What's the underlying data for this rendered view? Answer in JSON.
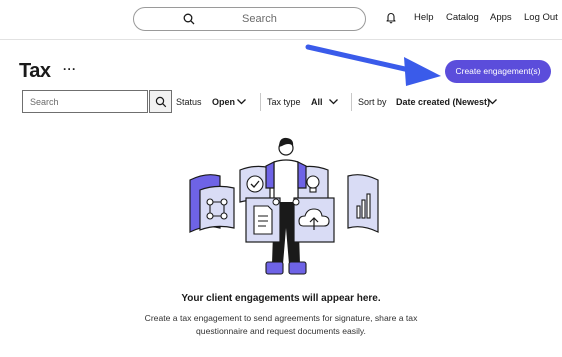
{
  "topbar": {
    "search_placeholder": "Search",
    "links": {
      "help": "Help",
      "catalog": "Catalog",
      "apps": "Apps",
      "logout": "Log Out"
    }
  },
  "page": {
    "title": "Tax",
    "more_label": "···",
    "create_button": "Create engagement(s)"
  },
  "filters": {
    "search_placeholder": "Search",
    "status_label": "Status",
    "status_value": "Open",
    "tax_type_label": "Tax type",
    "tax_type_value": "All",
    "sort_label": "Sort by",
    "sort_value": "Date created (Newest)"
  },
  "empty_state": {
    "title": "Your client engagements will appear here.",
    "description": "Create a tax engagement to send agreements for signature, share a tax questionnaire and request documents easily."
  },
  "colors": {
    "accent": "#5b4ddb",
    "illustration_purple": "#6e63e6",
    "illustration_light": "#d9dcf5",
    "annotation_arrow": "#3a5bea"
  },
  "icons": [
    "search-icon",
    "bell-icon",
    "chevron-down-icon",
    "more-icon"
  ]
}
